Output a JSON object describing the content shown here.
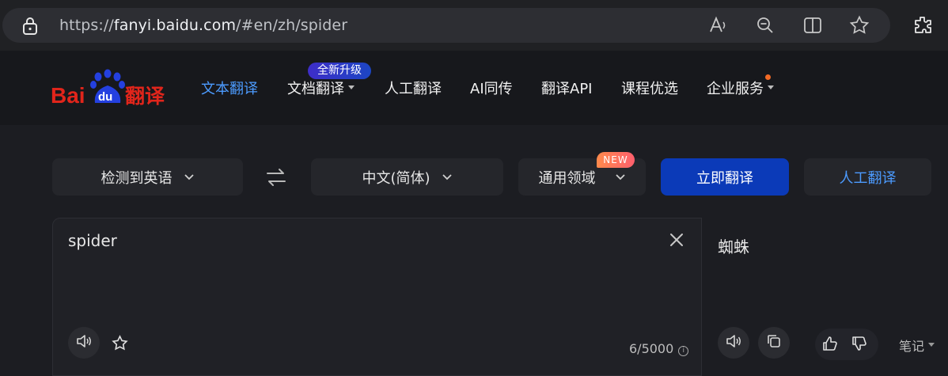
{
  "browser": {
    "url_scheme": "https://",
    "url_host": "fanyi.baidu.com",
    "url_path": "/#en/zh/spider"
  },
  "nav": {
    "logo_text_a": "Bai",
    "logo_text_b": "du",
    "logo_text_c": "翻译",
    "items": [
      {
        "label": "文本翻译"
      },
      {
        "label": "文档翻译"
      },
      {
        "label": "人工翻译"
      },
      {
        "label": "AI同传"
      },
      {
        "label": "翻译API"
      },
      {
        "label": "课程优选"
      },
      {
        "label": "企业服务"
      }
    ],
    "upgrade_badge": "全新升级"
  },
  "toolbar": {
    "source_lang": "检测到英语",
    "target_lang": "中文(简体)",
    "domain": "通用领域",
    "new_badge": "NEW",
    "translate_label": "立即翻译",
    "human_label": "人工翻译"
  },
  "input": {
    "text": "spider",
    "counter": "6/5000"
  },
  "output": {
    "text": "蜘蛛",
    "note_label": "笔记"
  },
  "colors": {
    "accent": "#4c9bff",
    "primary_button": "#0b3ab8",
    "badge_orange": "#ff7a55"
  }
}
